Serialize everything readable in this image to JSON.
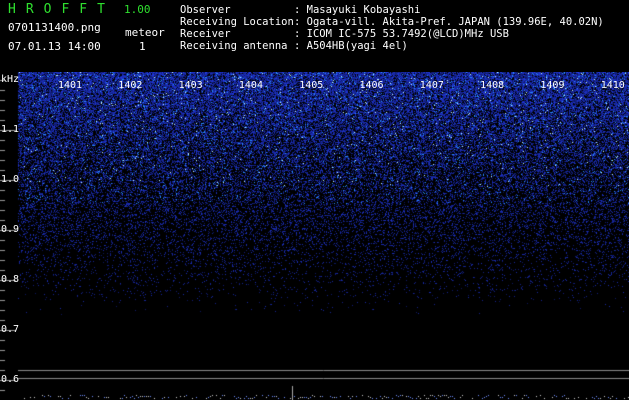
{
  "header": {
    "app_title": "HROFFT",
    "version": "1.00",
    "file_name": "0701131400.png",
    "meteor_label": "meteor",
    "datetime": "07.01.13 14:00",
    "meteor_count": "1"
  },
  "info": [
    {
      "key": "Observer",
      "value": ": Masayuki Kobayashi"
    },
    {
      "key": "Receiving Location",
      "value": ": Ogata-vill. Akita-Pref. JAPAN (139.96E, 40.02N)"
    },
    {
      "key": "Receiver",
      "value": ": ICOM IC-575 53.7492(@LCD)MHz USB"
    },
    {
      "key": "Receiving antenna",
      "value": ": A504HB(yagi 4el)"
    }
  ],
  "axis": {
    "unit": "kHz",
    "y_ticks": [
      "1.1",
      "1.0",
      "0.9",
      "0.8",
      "0.7",
      "0.6"
    ],
    "x_ticks": [
      "1401",
      "1402",
      "1403",
      "1404",
      "1405",
      "1406",
      "1407",
      "1408",
      "1409",
      "1410"
    ]
  },
  "colors": {
    "title_green": "#2fe02f",
    "noise_blue": "#2040ff",
    "grid": "#9a9a9a"
  }
}
